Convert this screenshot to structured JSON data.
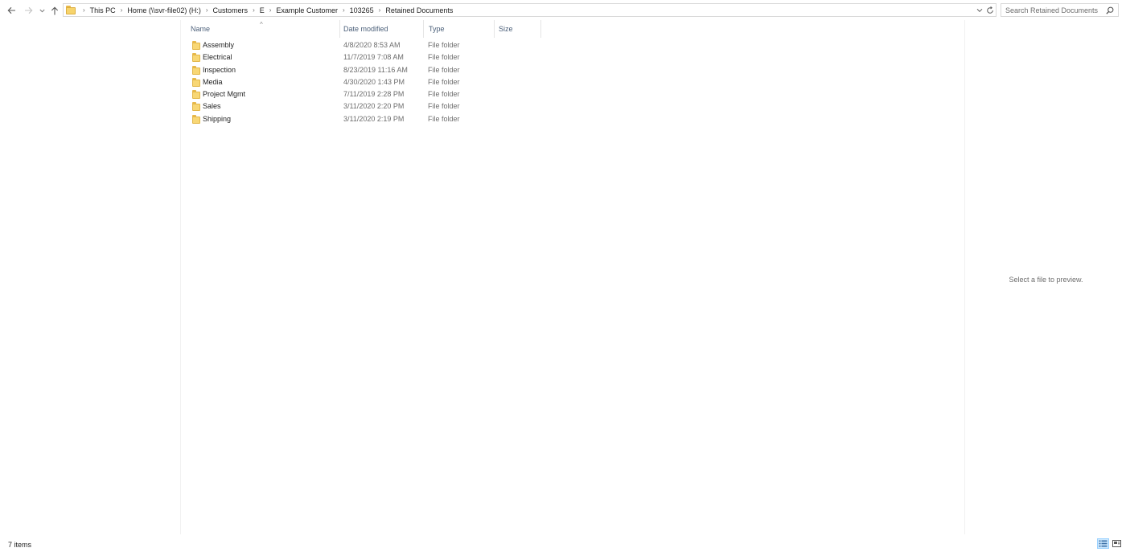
{
  "nav": {
    "back_icon": "arrow-left-icon",
    "forward_icon": "arrow-right-icon",
    "recent_icon": "chevron-down-icon",
    "up_icon": "arrow-up-icon"
  },
  "breadcrumb": [
    "This PC",
    "Home (\\\\svr-file02) (H:)",
    "Customers",
    "E",
    "Example Customer",
    "103265",
    "Retained Documents"
  ],
  "search": {
    "placeholder": "Search Retained Documents"
  },
  "columns": {
    "name": "Name",
    "date_modified": "Date modified",
    "type": "Type",
    "size": "Size"
  },
  "files": [
    {
      "name": "Assembly",
      "date": "4/8/2020 8:53 AM",
      "type": "File folder"
    },
    {
      "name": "Electrical",
      "date": "11/7/2019 7:08 AM",
      "type": "File folder"
    },
    {
      "name": "Inspection",
      "date": "8/23/2019 11:16 AM",
      "type": "File folder"
    },
    {
      "name": "Media",
      "date": "4/30/2020 1:43 PM",
      "type": "File folder"
    },
    {
      "name": "Project Mgmt",
      "date": "7/11/2019 2:28 PM",
      "type": "File folder"
    },
    {
      "name": "Sales",
      "date": "3/11/2020 2:20 PM",
      "type": "File folder"
    },
    {
      "name": "Shipping",
      "date": "3/11/2020 2:19 PM",
      "type": "File folder"
    }
  ],
  "preview": {
    "message": "Select a file to preview."
  },
  "status": {
    "item_count": "7 items"
  },
  "colors": {
    "folder": "#f8d775",
    "header_text": "#4c607a",
    "active_view": "#cce8ff"
  }
}
